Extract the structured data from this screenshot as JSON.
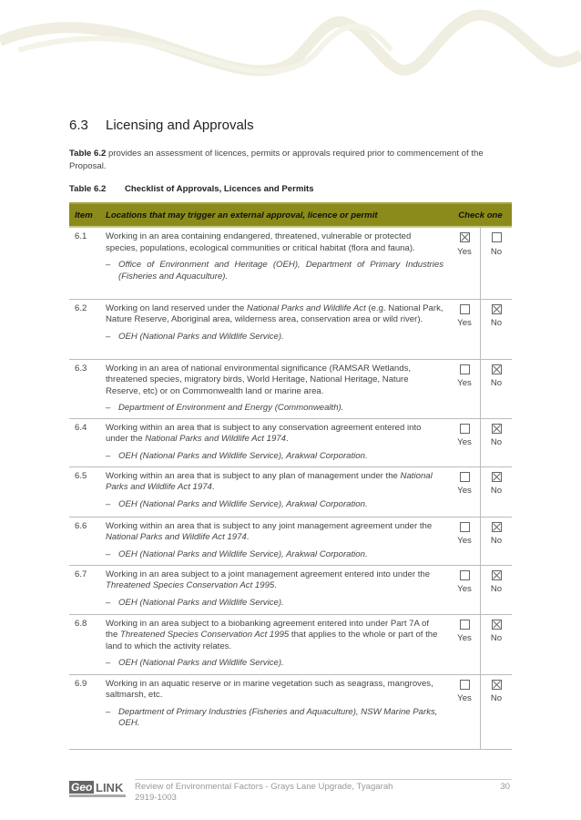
{
  "section": {
    "number": "6.3",
    "title": "Licensing and Approvals"
  },
  "intro": {
    "ref": "Table 6.2",
    "text": " provides an assessment of licences, permits or approvals required prior to commencement of the Proposal."
  },
  "caption": {
    "number": "Table 6.2",
    "title": "Checklist of Approvals, Licences and Permits"
  },
  "table": {
    "headers": {
      "item": "Item",
      "locations": "Locations that may trigger an external approval, licence or permit",
      "check": "Check one"
    },
    "yes_label": "Yes",
    "no_label": "No",
    "rows": [
      {
        "item": "6.1",
        "desc": [
          {
            "t": "Working in an area containing endangered, threatened, vulnerable or protected species, populations, ecological communities or critical habitat (flora and fauna)."
          }
        ],
        "authority": "Office of Environment and Heritage (OEH), Department of Primary Industries (Fisheries and Aquaculture).",
        "yes": true,
        "no": false
      },
      {
        "item": "6.2",
        "desc": [
          {
            "t": "Working on land reserved under the "
          },
          {
            "t": "National Parks and Wildlife Act",
            "i": true
          },
          {
            "t": " (e.g. National Park, Nature Reserve, Aboriginal area, wilderness area, conservation area or wild river)."
          }
        ],
        "authority": "OEH (National Parks and Wildlife Service).",
        "yes": false,
        "no": true
      },
      {
        "item": "6.3",
        "desc": [
          {
            "t": "Working in an area of national environmental significance (RAMSAR Wetlands, threatened species, migratory birds, World Heritage, National Heritage, Nature Reserve, etc) or on Commonwealth land or marine area."
          }
        ],
        "authority": "Department of Environment and Energy (Commonwealth).",
        "yes": false,
        "no": true
      },
      {
        "item": "6.4",
        "desc": [
          {
            "t": "Working within an area that is subject to any conservation agreement entered into under the "
          },
          {
            "t": "National Parks and Wildlife Act 1974",
            "i": true
          },
          {
            "t": "."
          }
        ],
        "authority": "OEH (National Parks and Wildlife Service), Arakwal Corporation.",
        "yes": false,
        "no": true
      },
      {
        "item": "6.5",
        "desc": [
          {
            "t": "Working within an area that is subject to any plan of management under the "
          },
          {
            "t": "National Parks and Wildlife Act 1974",
            "i": true
          },
          {
            "t": "."
          }
        ],
        "authority": "OEH (National Parks and Wildlife Service), Arakwal Corporation.",
        "yes": false,
        "no": true
      },
      {
        "item": "6.6",
        "desc": [
          {
            "t": "Working within an area that is subject to any joint management agreement under the "
          },
          {
            "t": "National Parks and Wildlife Act 1974",
            "i": true
          },
          {
            "t": "."
          }
        ],
        "authority": "OEH (National Parks and Wildlife Service), Arakwal Corporation.",
        "yes": false,
        "no": true
      },
      {
        "item": "6.7",
        "desc": [
          {
            "t": "Working in an area subject to a joint management agreement entered into under the "
          },
          {
            "t": "Threatened Species Conservation Act 1995",
            "i": true
          },
          {
            "t": "."
          }
        ],
        "authority": "OEH (National Parks and Wildlife Service).",
        "yes": false,
        "no": true
      },
      {
        "item": "6.8",
        "desc": [
          {
            "t": "Working in an area subject to a biobanking agreement entered into under Part 7A of the "
          },
          {
            "t": "Threatened Species Conservation Act 1995",
            "i": true
          },
          {
            "t": " that applies to the whole or part of the land to which the activity relates."
          }
        ],
        "authority": "OEH (National Parks and Wildlife Service).",
        "yes": false,
        "no": true
      },
      {
        "item": "6.9",
        "desc": [
          {
            "t": "Working in an aquatic reserve or in marine vegetation such as seagrass, mangroves, saltmarsh, etc."
          }
        ],
        "authority": "Department of Primary Industries (Fisheries and Aquaculture), NSW Marine Parks, OEH.",
        "yes": false,
        "no": true
      }
    ]
  },
  "footer": {
    "logo": "GeoLINK",
    "title": "Review of Environmental Factors - Grays Lane Upgrade, Tyagarah",
    "ref": "2919-1003",
    "page": "30"
  },
  "colors": {
    "header_bg": "#8b8b1c",
    "wave": "#efeee0"
  }
}
